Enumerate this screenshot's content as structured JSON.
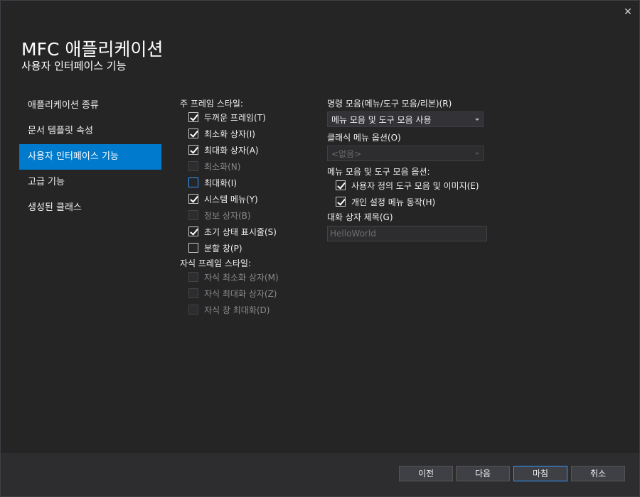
{
  "window": {
    "close_glyph": "✕"
  },
  "header": {
    "title": "MFC 애플리케이션",
    "subtitle": "사용자 인터페이스 기능"
  },
  "sidebar": {
    "items": [
      {
        "label": "애플리케이션 종류",
        "active": false
      },
      {
        "label": "문서 템플릿 속성",
        "active": false
      },
      {
        "label": "사용자 인터페이스 기능",
        "active": true
      },
      {
        "label": "고급 기능",
        "active": false
      },
      {
        "label": "생성된 클래스",
        "active": false
      }
    ]
  },
  "main_frame": {
    "label": "주 프레임 스타일:",
    "options": [
      {
        "label": "두꺼운 프레임(T)",
        "checked": true,
        "enabled": true
      },
      {
        "label": "최소화 상자(I)",
        "checked": true,
        "enabled": true
      },
      {
        "label": "최대화 상자(A)",
        "checked": true,
        "enabled": true
      },
      {
        "label": "최소화(N)",
        "checked": false,
        "enabled": false
      },
      {
        "label": "최대화(I)",
        "checked": false,
        "enabled": true
      },
      {
        "label": "시스템 메뉴(Y)",
        "checked": true,
        "enabled": true
      },
      {
        "label": "정보 상자(B)",
        "checked": false,
        "enabled": false
      },
      {
        "label": "초기 상태 표시줄(S)",
        "checked": true,
        "enabled": true
      },
      {
        "label": "분할 창(P)",
        "checked": false,
        "enabled": true
      }
    ]
  },
  "child_frame": {
    "label": "자식 프레임 스타일:",
    "options": [
      {
        "label": "자식 최소화 상자(M)",
        "checked": false,
        "enabled": false
      },
      {
        "label": "자식 최대화 상자(Z)",
        "checked": false,
        "enabled": false
      },
      {
        "label": "자식 창 최대화(D)",
        "checked": false,
        "enabled": false
      }
    ]
  },
  "command_bars": {
    "label": "명령 모음(메뉴/도구 모음/리본)(R)",
    "value": "메뉴 모음 및 도구 모음 사용"
  },
  "classic_menu": {
    "label": "클래식 메뉴 옵션(O)",
    "value": "<없음>",
    "enabled": false
  },
  "menu_toolbar_options": {
    "label": "메뉴 모음 및 도구 모음 옵션:",
    "options": [
      {
        "label": "사용자 정의 도구 모음 및 이미지(E)",
        "checked": true,
        "enabled": true
      },
      {
        "label": "개인 설정 메뉴 동작(H)",
        "checked": true,
        "enabled": true
      }
    ]
  },
  "dialog_title": {
    "label": "대화 상자 제목(G)",
    "value": "HelloWorld",
    "enabled": false
  },
  "footer": {
    "prev": "이전",
    "next": "다음",
    "finish": "마침",
    "cancel": "취소"
  }
}
